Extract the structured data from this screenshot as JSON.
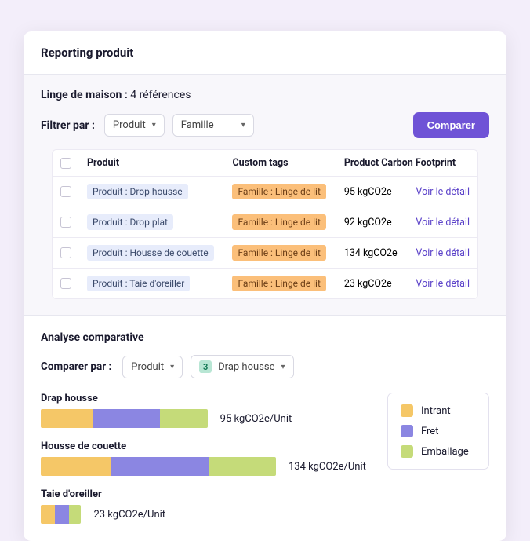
{
  "header": {
    "title": "Reporting produit"
  },
  "filter": {
    "category_label": "Linge de maison :",
    "ref_text": "4 références",
    "filter_label": "Filtrer par :",
    "select1": "Produit",
    "select2": "Famille",
    "compare_btn": "Comparer"
  },
  "table": {
    "cols": {
      "produit": "Produit",
      "tags": "Custom tags",
      "pcf": "Product Carbon Footprint"
    },
    "detail_label": "Voir le détail",
    "rows": [
      {
        "produit": "Produit : Drop housse",
        "tag": "Famille : Linge de lit",
        "pcf": "95 kgCO2e"
      },
      {
        "produit": "Produit : Drop plat",
        "tag": "Famille : Linge de lit",
        "pcf": "92 kgCO2e"
      },
      {
        "produit": "Produit : Housse de couette",
        "tag": "Famille : Linge de lit",
        "pcf": "134 kgCO2e"
      },
      {
        "produit": "Produit : Taie d'oreiller",
        "tag": "Famille : Linge de lit",
        "pcf": "23 kgCO2e"
      }
    ]
  },
  "analysis": {
    "title": "Analyse comparative",
    "compare_label": "Comparer par :",
    "select1": "Produit",
    "select2_count": "3",
    "select2": "Drap housse",
    "legend": {
      "intrant": "Intrant",
      "fret": "Fret",
      "emballage": "Emballage"
    }
  },
  "chart_data": {
    "type": "bar",
    "orientation": "horizontal",
    "stacked": true,
    "unit": "kgCO2e/Unit",
    "max": 134,
    "series_names": [
      "Intrant",
      "Fret",
      "Emballage"
    ],
    "colors": {
      "Intrant": "#f5c767",
      "Fret": "#8b86e2",
      "Emballage": "#c5db79"
    },
    "items": [
      {
        "name": "Drap housse",
        "total": 95,
        "label": "95 kgCO2e/Unit",
        "segments": [
          30,
          38,
          27
        ]
      },
      {
        "name": "Housse de couette",
        "total": 134,
        "label": "134 kgCO2e/Unit",
        "segments": [
          40,
          56,
          38
        ]
      },
      {
        "name": "Taie d'oreiller",
        "total": 23,
        "label": "23 kgCO2e/Unit",
        "segments": [
          8,
          8,
          7
        ]
      }
    ]
  }
}
